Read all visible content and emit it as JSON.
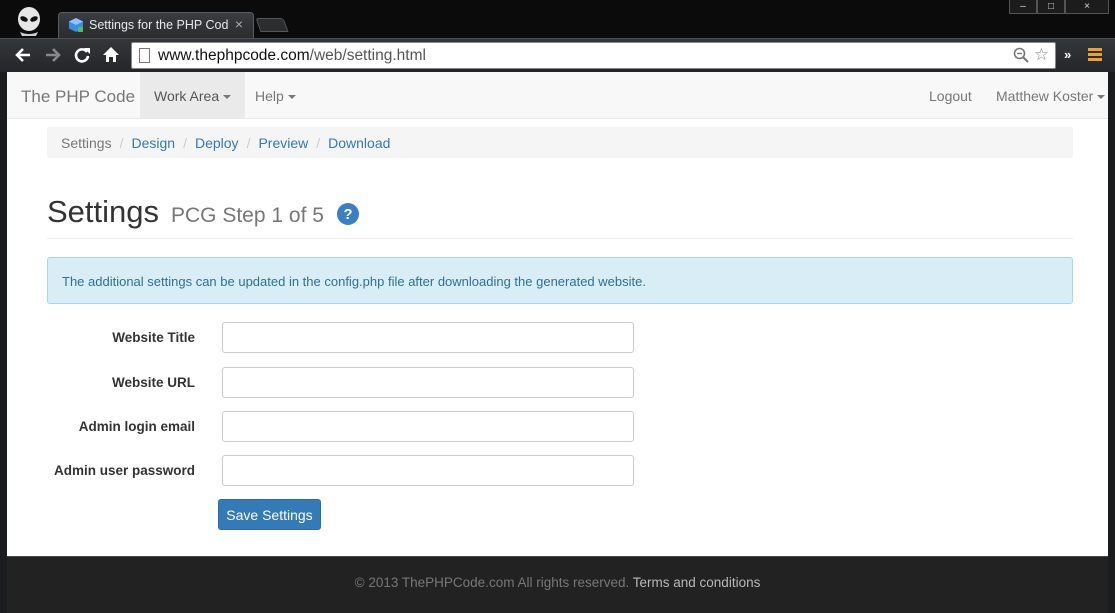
{
  "browser": {
    "tab_title": "Settings for the PHP Code",
    "tab_close": "×",
    "url_host": "www.thephpcode.com",
    "url_path": "/web/setting.html",
    "window_controls": [
      "–",
      "□",
      "×"
    ],
    "overflow_label": "»"
  },
  "navbar": {
    "brand": "The PHP Code",
    "items": [
      {
        "label": "Work Area",
        "dropdown": true
      },
      {
        "label": "Help",
        "dropdown": true
      }
    ],
    "logout": "Logout",
    "user": "Matthew Koster"
  },
  "breadcrumb": {
    "items": [
      {
        "label": "Settings",
        "current": true
      },
      {
        "label": "Design",
        "current": false
      },
      {
        "label": "Deploy",
        "current": false
      },
      {
        "label": "Preview",
        "current": false
      },
      {
        "label": "Download",
        "current": false
      }
    ],
    "separator": "/"
  },
  "header": {
    "title": "Settings",
    "subtitle": "PCG Step 1 of 5",
    "help_glyph": "?"
  },
  "alert": {
    "text": "The additional settings can be updated in the config.php file after downloading the generated website."
  },
  "form": {
    "fields": [
      {
        "label": "Website Title",
        "value": "",
        "type": "text"
      },
      {
        "label": "Website URL",
        "value": "",
        "type": "text"
      },
      {
        "label": "Admin login email",
        "value": "",
        "type": "email"
      },
      {
        "label": "Admin user password",
        "value": "",
        "type": "password"
      }
    ],
    "submit_label": "Save Settings"
  },
  "footer": {
    "copyright": "© 2013 ThePHPCode.com All rights reserved.",
    "terms": "Terms and conditions"
  },
  "colors": {
    "link": "#337ab7",
    "primary_button": "#337ab7",
    "alert_bg": "#d9edf7",
    "alert_text": "#31708f",
    "footer_bg": "#222222",
    "menu_accent": "#f0a030"
  },
  "icons": [
    "alien-icon",
    "favicon-icon",
    "back-icon",
    "forward-icon",
    "reload-icon",
    "home-icon",
    "page-icon",
    "zoom-icon",
    "star-icon",
    "menu-icon",
    "help-icon",
    "caret-down-icon"
  ]
}
